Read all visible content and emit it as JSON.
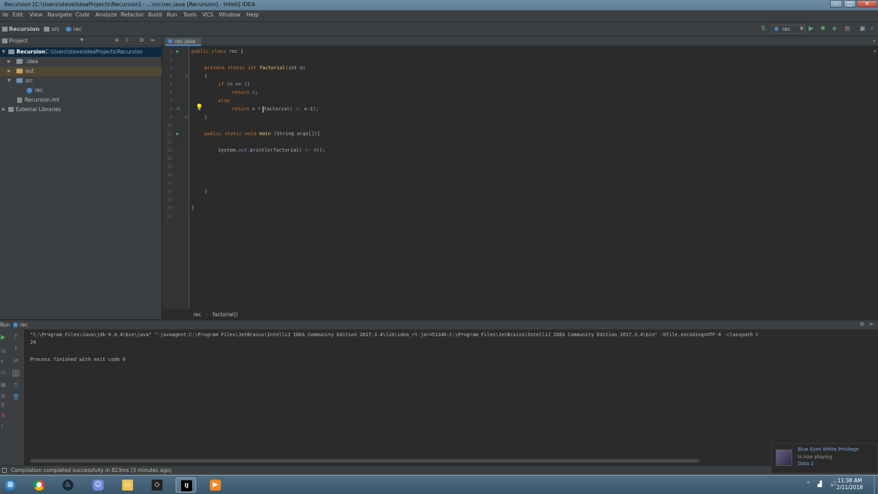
{
  "window": {
    "title": "Recursion [C:\\Users\\steve\\IdeaProjects\\Recursion] - ...\\src\\rec.java [Recursion] - IntelliJ IDEA"
  },
  "menu": [
    "ile",
    "Edit",
    "View",
    "Navigate",
    "Code",
    "Analyze",
    "Refactor",
    "Build",
    "Run",
    "Tools",
    "VCS",
    "Window",
    "Help"
  ],
  "navbar": {
    "crumbs": [
      "Recursion",
      "src",
      "rec"
    ],
    "run_config": "rec"
  },
  "project": {
    "header": "Project",
    "tree": [
      {
        "label": "Recursion",
        "path": "C:\\Users\\steve\\IdeaProjects\\Recursion"
      },
      {
        "label": ".idea"
      },
      {
        "label": "out"
      },
      {
        "label": "src"
      },
      {
        "label": "rec"
      },
      {
        "label": "Recursion.iml"
      },
      {
        "label": "External Libraries"
      }
    ]
  },
  "editor": {
    "tab": "rec.java",
    "line_numbers": [
      "1",
      "2",
      "3",
      "4",
      "5",
      "6",
      "7",
      "8",
      "9",
      "10",
      "11",
      "12",
      "13",
      "14",
      "15",
      "16",
      "17",
      "18",
      "19",
      "20",
      "21"
    ],
    "breadcrumb": [
      "rec",
      "factorial()"
    ],
    "code": {
      "l1_kw": "public class ",
      "l1_rest": "rec {",
      "l3_kw": "private static int ",
      "l3_fn": "factorial",
      "l3_rest": "(int n)",
      "l4": "{",
      "l5_kw": "if ",
      "l5_a": "(n == ",
      "l5_num": "1",
      "l5_b": ")",
      "l6_kw": "return ",
      "l6_num": "1",
      "l6_b": ";",
      "l7_kw": "else",
      "l8_kw": "return ",
      "l8_a": "n * factorial(",
      "l8_hint": " n: ",
      "l8_b": "n-1);",
      "l9": "}",
      "l11_kw": "public static void ",
      "l11_fn": "main",
      "l11_rest": " (String args[]){",
      "l13_a": "System.",
      "l13_fld": "out",
      "l13_b": ".println(factorial(",
      "l13_hint": " n: ",
      "l13_num": "4",
      "l13_c": "));",
      "l18": "}",
      "l20": "}"
    }
  },
  "run": {
    "header_left": "Run",
    "header_tab": "rec",
    "console": [
      "\"C:\\Program Files\\Java\\jdk-9.0.4\\bin\\java\" \"-javaagent:C:\\Program Files\\JetBrains\\IntelliJ IDEA Community Edition 2017.3.4\\lib\\idea_rt.jar=51346:C:\\Program Files\\JetBrains\\IntelliJ IDEA Community Edition 2017.3.4\\bin\" -Dfile.encoding=UTF-8 -classpath C",
      "24",
      "",
      "Process finished with exit code 0"
    ]
  },
  "status": {
    "message": "Compilation completed successfully in 823ms (3 minutes ago)"
  },
  "notification": {
    "line1": "Blue Eyes White Privilege",
    "line2": "is now playing",
    "line3": "Dota 2"
  },
  "taskbar": {
    "time": "11:38 AM",
    "date": "2/11/2018"
  },
  "colors": {
    "accent": "#4a88c7",
    "run_green": "#59a869",
    "error_red": "#c75450",
    "notification_blue": "#7aa6da"
  }
}
